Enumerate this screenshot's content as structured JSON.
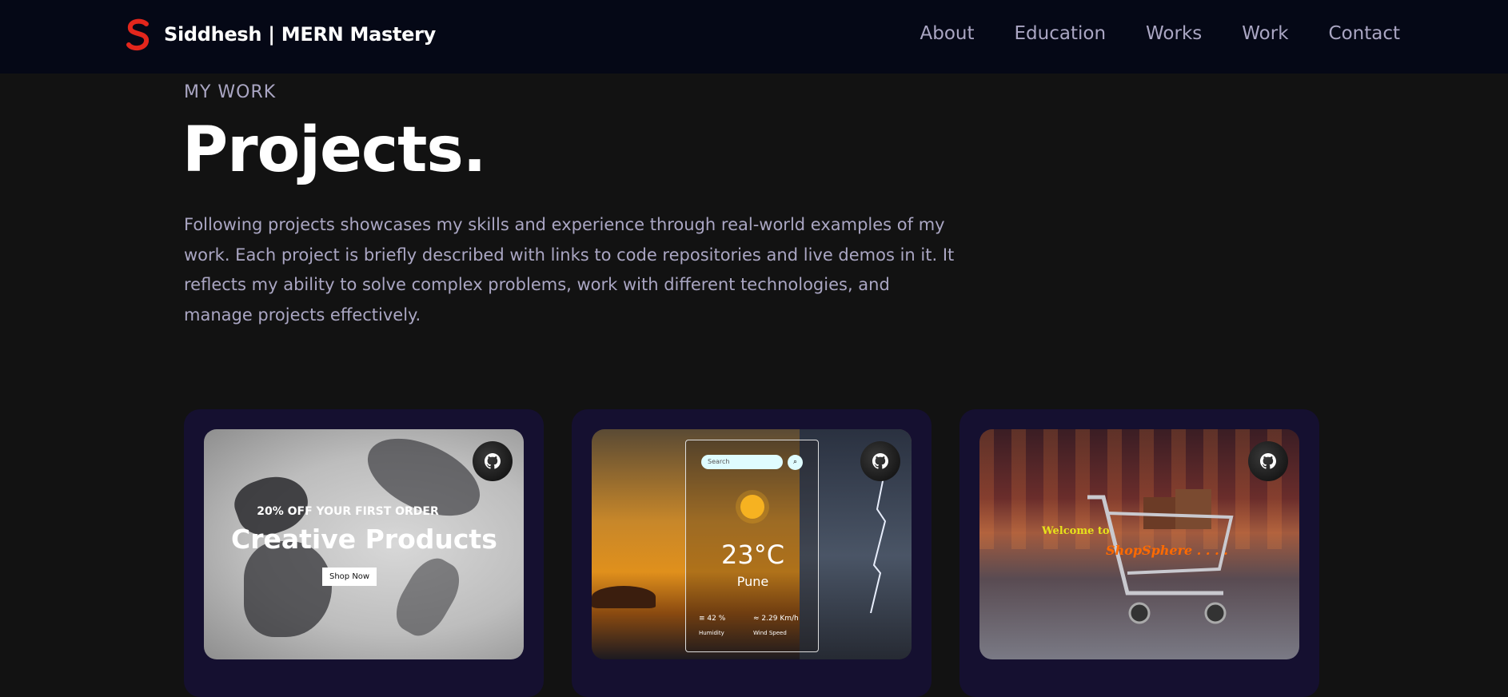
{
  "nav": {
    "brand": "Siddhesh | MERN Mastery",
    "links": [
      "About",
      "Education",
      "Works",
      "Work",
      "Contact"
    ]
  },
  "section": {
    "eyebrow": "MY WORK",
    "title": "Projects.",
    "description": "Following projects showcases my skills and experience through real-world examples of my work. Each project is briefly described with links to code repositories and live demos in it. It reflects my ability to solve complex problems, work with different technologies, and manage projects effectively."
  },
  "cards": [
    {
      "kicker": "20% OFF YOUR FIRST ORDER",
      "headline": "Creative Products",
      "button": "Shop Now"
    },
    {
      "search_placeholder": "Search",
      "temperature": "23°C",
      "city": "Pune",
      "humidity_value": "42 %",
      "humidity_label": "Humidity",
      "wind_value": "2.29 Km/h",
      "wind_label": "Wind Speed"
    },
    {
      "welcome": "Welcome to",
      "store": "ShopSphere . . . ."
    }
  ],
  "icons": [
    "logo-icon",
    "github-icon",
    "search-icon",
    "sun-icon",
    "humidity-icon",
    "wind-icon"
  ],
  "colors": {
    "nav_bg": "#050816",
    "page_bg": "#121212",
    "card_bg": "#151030",
    "muted_text": "#aaa6c3"
  }
}
